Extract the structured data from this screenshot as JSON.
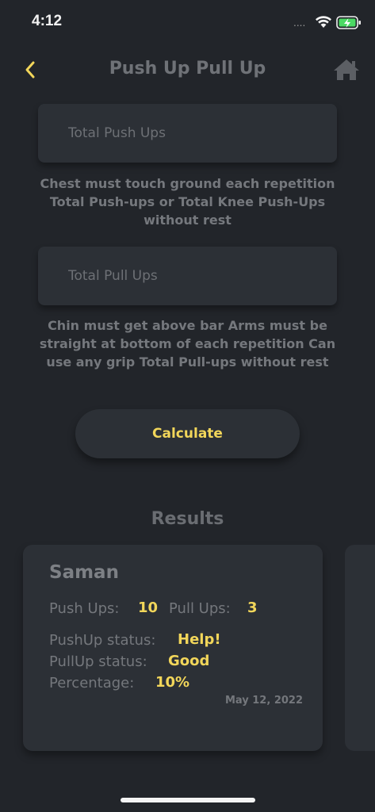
{
  "status_bar": {
    "time": "4:12",
    "signal_dots": "....",
    "wifi_icon": "wifi-icon",
    "battery_icon": "battery-charging-icon",
    "battery_color": "#4cd964"
  },
  "header": {
    "title": "Push Up Pull Up",
    "back_icon": "chevron-left-icon",
    "home_icon": "home-icon",
    "accent_color": "#f2d65a"
  },
  "form": {
    "push_ups": {
      "placeholder": "Total Push Ups",
      "value": ""
    },
    "push_ups_hint": "Chest must touch ground each repetition Total Push-ups or Total Knee Push-Ups without rest",
    "pull_ups": {
      "placeholder": "Total Pull Ups",
      "value": ""
    },
    "pull_ups_hint": "Chin must get above bar Arms must be straight at bottom of each repetition Can use any grip Total Pull-ups without rest",
    "calculate_label": "Calculate"
  },
  "results": {
    "title": "Results",
    "cards": [
      {
        "name": "Saman",
        "push_ups_label": "Push Ups:",
        "push_ups_value": "10",
        "pull_ups_label": "Pull Ups:",
        "pull_ups_value": "3",
        "pushup_status_label": "PushUp status:",
        "pushup_status_value": "Help!",
        "pullup_status_label": "PullUp status:",
        "pullup_status_value": "Good",
        "percentage_label": "Percentage:",
        "percentage_value": "10%",
        "date": "May 12, 2022"
      }
    ]
  }
}
